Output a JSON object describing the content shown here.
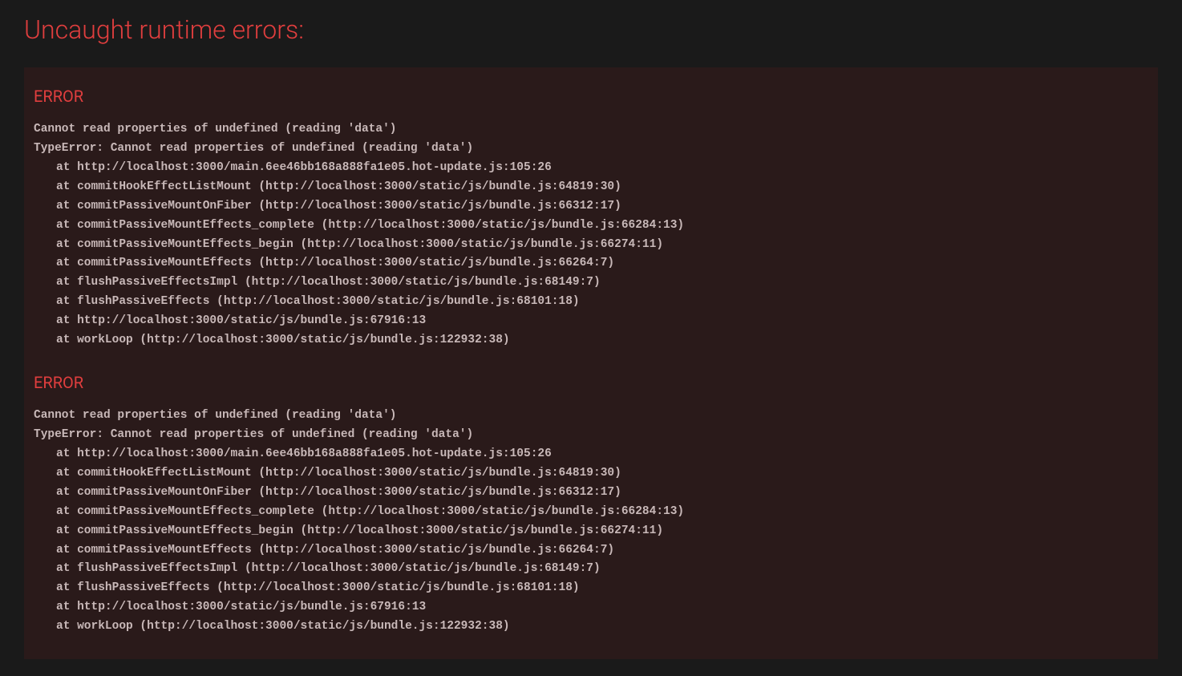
{
  "title": "Uncaught runtime errors:",
  "errors": [
    {
      "label": "ERROR",
      "message": "Cannot read properties of undefined (reading 'data')",
      "type_line": "TypeError: Cannot read properties of undefined (reading 'data')",
      "stack": [
        "at http://localhost:3000/main.6ee46bb168a888fa1e05.hot-update.js:105:26",
        "at commitHookEffectListMount (http://localhost:3000/static/js/bundle.js:64819:30)",
        "at commitPassiveMountOnFiber (http://localhost:3000/static/js/bundle.js:66312:17)",
        "at commitPassiveMountEffects_complete (http://localhost:3000/static/js/bundle.js:66284:13)",
        "at commitPassiveMountEffects_begin (http://localhost:3000/static/js/bundle.js:66274:11)",
        "at commitPassiveMountEffects (http://localhost:3000/static/js/bundle.js:66264:7)",
        "at flushPassiveEffectsImpl (http://localhost:3000/static/js/bundle.js:68149:7)",
        "at flushPassiveEffects (http://localhost:3000/static/js/bundle.js:68101:18)",
        "at http://localhost:3000/static/js/bundle.js:67916:13",
        "at workLoop (http://localhost:3000/static/js/bundle.js:122932:38)"
      ]
    },
    {
      "label": "ERROR",
      "message": "Cannot read properties of undefined (reading 'data')",
      "type_line": "TypeError: Cannot read properties of undefined (reading 'data')",
      "stack": [
        "at http://localhost:3000/main.6ee46bb168a888fa1e05.hot-update.js:105:26",
        "at commitHookEffectListMount (http://localhost:3000/static/js/bundle.js:64819:30)",
        "at commitPassiveMountOnFiber (http://localhost:3000/static/js/bundle.js:66312:17)",
        "at commitPassiveMountEffects_complete (http://localhost:3000/static/js/bundle.js:66284:13)",
        "at commitPassiveMountEffects_begin (http://localhost:3000/static/js/bundle.js:66274:11)",
        "at commitPassiveMountEffects (http://localhost:3000/static/js/bundle.js:66264:7)",
        "at flushPassiveEffectsImpl (http://localhost:3000/static/js/bundle.js:68149:7)",
        "at flushPassiveEffects (http://localhost:3000/static/js/bundle.js:68101:18)",
        "at http://localhost:3000/static/js/bundle.js:67916:13",
        "at workLoop (http://localhost:3000/static/js/bundle.js:122932:38)"
      ]
    }
  ]
}
